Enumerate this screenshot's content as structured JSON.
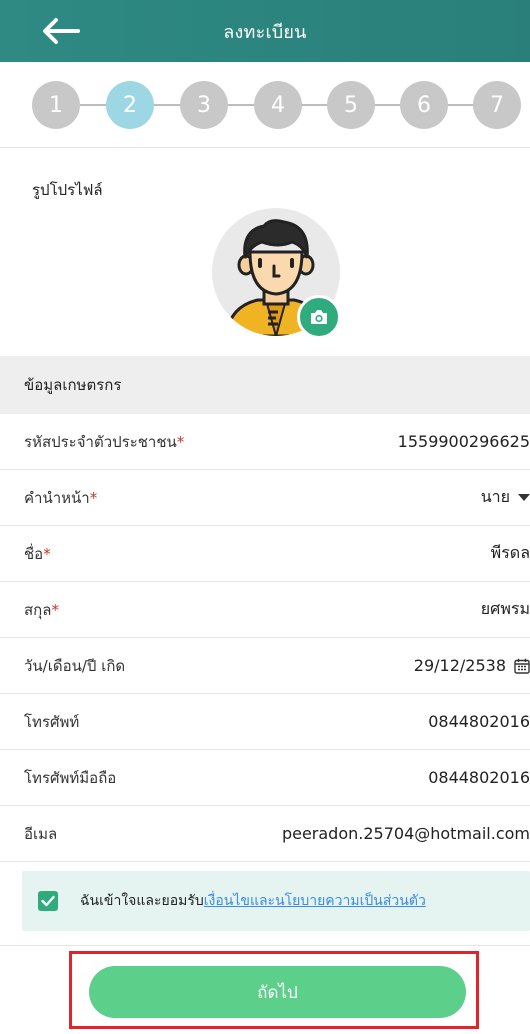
{
  "header": {
    "title": "ลงทะเบียน"
  },
  "stepper": {
    "steps": [
      "1",
      "2",
      "3",
      "4",
      "5",
      "6",
      "7"
    ],
    "active_step": "2"
  },
  "profile": {
    "label": "รูปโปรไฟล์"
  },
  "section": {
    "title": "ข้อมูลเกษตรกร"
  },
  "fields": [
    {
      "label": "รหัสประจำตัวประชาชน",
      "required": "*",
      "value": "1559900296625"
    },
    {
      "label": "คำนำหน้า",
      "required": "*",
      "value": "นาย"
    },
    {
      "label": "ชื่อ",
      "required": "*",
      "value": "พีรดล"
    },
    {
      "label": "สกุล",
      "required": "*",
      "value": "ยศพรม"
    },
    {
      "label": "วัน/เดือน/ปี เกิด",
      "required": "",
      "value": "29/12/2538"
    },
    {
      "label": "โทรศัพท์",
      "required": "",
      "value": "0844802016"
    },
    {
      "label": "โทรศัพท์มือถือ",
      "required": "",
      "value": "0844802016"
    },
    {
      "label": "อีเมล",
      "required": "",
      "value": "peeradon.25704@hotmail.com"
    }
  ],
  "consent": {
    "checked": true,
    "prefix": "ฉันเข้าใจและยอมรับ",
    "link": "เงื่อนไขและนโยบายความเป็นส่วนตัว"
  },
  "footer": {
    "next_label": "ถัดไป"
  },
  "colors": {
    "header": "#2e8a83",
    "active_step": "#9ed7e4",
    "inactive_step": "#c8c8c8",
    "accent": "#2fab7e",
    "button": "#5ccf8a",
    "highlight": "#e0242b",
    "link": "#3a8de0"
  },
  "icons": {
    "back": "arrow-left-icon",
    "camera": "camera-icon",
    "dropdown": "caret-down-icon",
    "calendar": "calendar-icon",
    "check": "check-icon"
  }
}
